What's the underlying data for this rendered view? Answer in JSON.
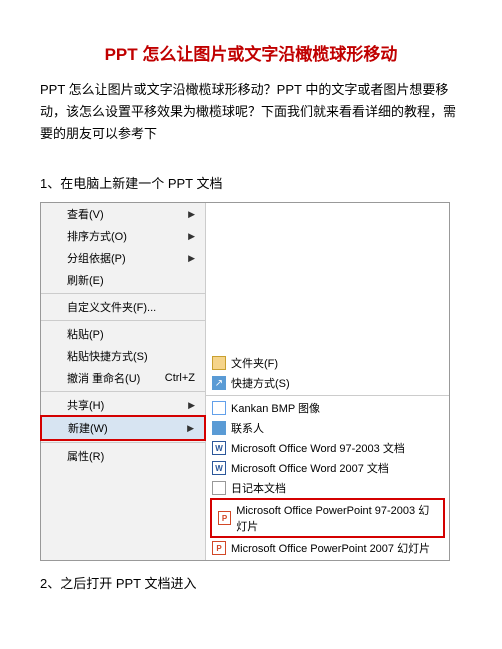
{
  "title": "PPT 怎么让图片或文字沿橄榄球形移动",
  "intro": "PPT 怎么让图片或文字沿橄榄球形移动？PPT 中的文字或者图片想要移动，该怎么设置平移效果为橄榄球呢？下面我们就来看看详细的教程，需要的朋友可以参考下",
  "step1": "1、在电脑上新建一个 PPT 文档",
  "step2": "2、之后打开 PPT 文档进入",
  "leftMenu": {
    "view": "查看(V)",
    "sort": "排序方式(O)",
    "group": "分组依据(P)",
    "refresh": "刷新(E)",
    "custom": "自定义文件夹(F)...",
    "paste": "粘贴(P)",
    "pasteShortcut": "粘贴快捷方式(S)",
    "undo": "撤消 重命名(U)",
    "undoKey": "Ctrl+Z",
    "share": "共享(H)",
    "new": "新建(W)",
    "prop": "属性(R)"
  },
  "rightMenu": {
    "folder": "文件夹(F)",
    "shortcut": "快捷方式(S)",
    "bmp": "Kankan BMP 图像",
    "contact": "联系人",
    "word97": "Microsoft Office Word 97-2003 文档",
    "word07": "Microsoft Office Word 2007 文档",
    "journal": "日记本文档",
    "ppt97": "Microsoft Office PowerPoint 97-2003 幻灯片",
    "ppt07": "Microsoft Office PowerPoint 2007 幻灯片"
  }
}
